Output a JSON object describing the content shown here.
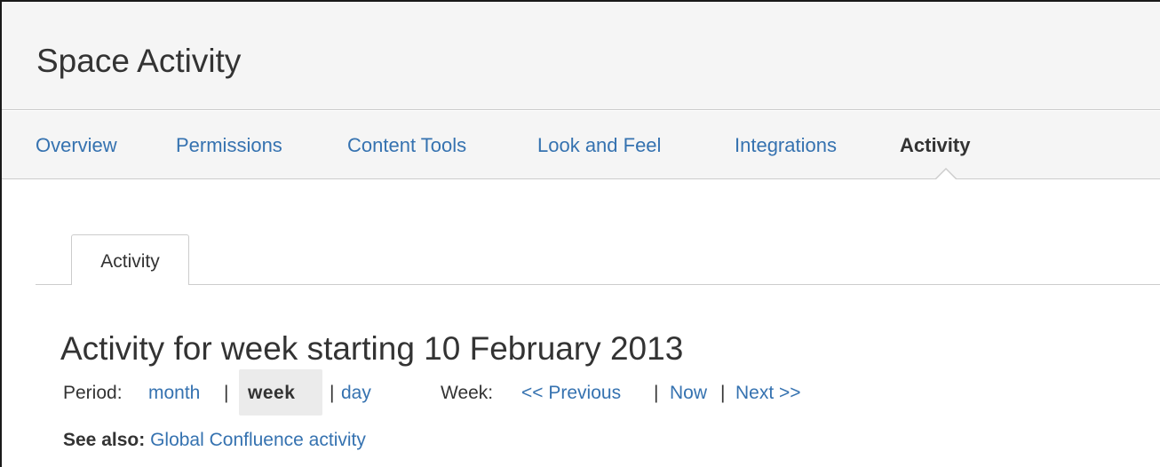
{
  "header": {
    "title": "Space Activity"
  },
  "nav": {
    "items": [
      {
        "label": "Overview"
      },
      {
        "label": "Permissions"
      },
      {
        "label": "Content Tools"
      },
      {
        "label": "Look and Feel"
      },
      {
        "label": "Integrations"
      },
      {
        "label": "Activity"
      }
    ],
    "active_item": "Activity"
  },
  "tabs": [
    {
      "label": "Activity"
    }
  ],
  "main": {
    "heading": "Activity for week starting 10 February 2013",
    "period": {
      "label": "Period:",
      "month": "month",
      "sep1": "|",
      "week": "week",
      "sep2": "|",
      "day": "day"
    },
    "week_nav": {
      "label": "Week:",
      "previous": "<< Previous",
      "sep1": "|",
      "now": "Now",
      "sep2": "|",
      "next": "Next >>"
    },
    "see_also": {
      "label": "See also:",
      "link": "Global Confluence activity"
    }
  },
  "colors": {
    "link": "#3572b0",
    "text": "#333333",
    "header_bg": "#f5f5f5",
    "border": "#cccccc",
    "selected_bg": "#ebebeb"
  }
}
